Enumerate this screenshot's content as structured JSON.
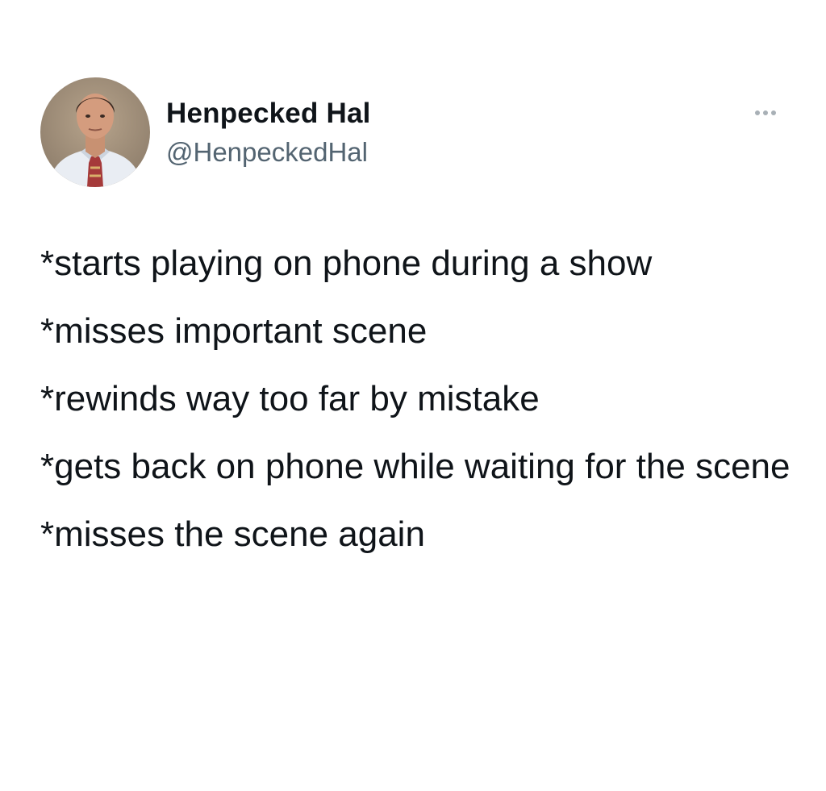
{
  "author": {
    "display_name": "Henpecked Hal",
    "handle": "@HenpeckedHal"
  },
  "menu": {
    "icon": "more-options-icon"
  },
  "tweet": {
    "lines": [
      "*starts playing on phone during a show",
      "*misses important scene",
      "*rewinds way too far by mistake",
      "*gets back on phone while waiting for the scene",
      "*misses the scene again"
    ]
  },
  "colors": {
    "text": "#0f1419",
    "secondary_text": "#536471",
    "background": "#ffffff"
  }
}
